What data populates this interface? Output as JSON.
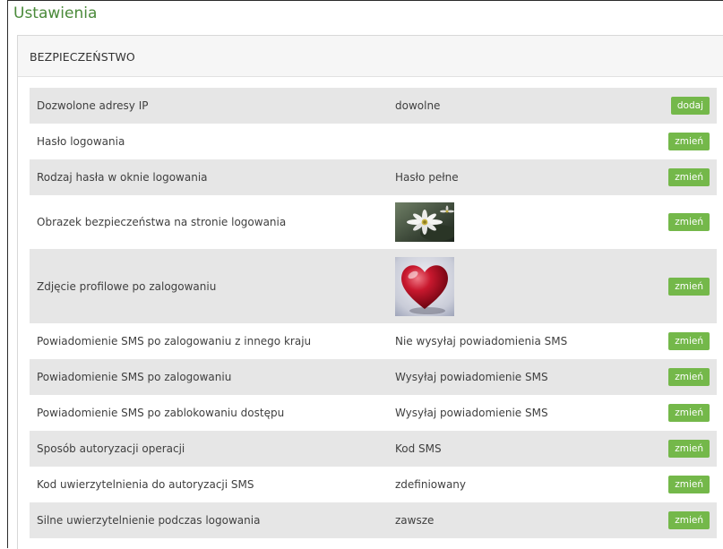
{
  "page": {
    "title": "Ustawienia"
  },
  "section": {
    "title": "BEZPIECZEŃSTWO"
  },
  "rows": [
    {
      "label": "Dozwolone adresy IP",
      "value": "dowolne",
      "button": "dodaj"
    },
    {
      "label": "Hasło logowania",
      "value": "",
      "button": "zmień"
    },
    {
      "label": "Rodzaj hasła w oknie logowania",
      "value": "Hasło pełne",
      "button": "zmień"
    },
    {
      "label": "Obrazek bezpieczeństwa na stronie logowania",
      "image": "daisy-flowers-image",
      "button": "zmień"
    },
    {
      "label": "Zdjęcie profilowe po zalogowaniu",
      "image": "red-heart-image",
      "button": "zmień"
    },
    {
      "label": "Powiadomienie SMS po zalogowaniu z innego kraju",
      "value": "Nie wysyłaj powiadomienia SMS",
      "button": "zmień"
    },
    {
      "label": "Powiadomienie SMS po zalogowaniu",
      "value": "Wysyłaj powiadomienie SMS",
      "button": "zmień"
    },
    {
      "label": "Powiadomienie SMS po zablokowaniu dostępu",
      "value": "Wysyłaj powiadomienie SMS",
      "button": "zmień"
    },
    {
      "label": "Sposób autoryzacji operacji",
      "value": "Kod SMS",
      "button": "zmień"
    },
    {
      "label": "Kod uwierzytelnienia do autoryzacji SMS",
      "value": "zdefiniowany",
      "button": "zmień"
    },
    {
      "label": "Silne uwierzytelnienie podczas logowania",
      "value": "zawsze",
      "button": "zmień"
    }
  ],
  "colors": {
    "title": "#4a8a3a",
    "button": "#74b84a",
    "row_shade": "#e6e6e6",
    "header_bg": "#f6f6f6"
  }
}
